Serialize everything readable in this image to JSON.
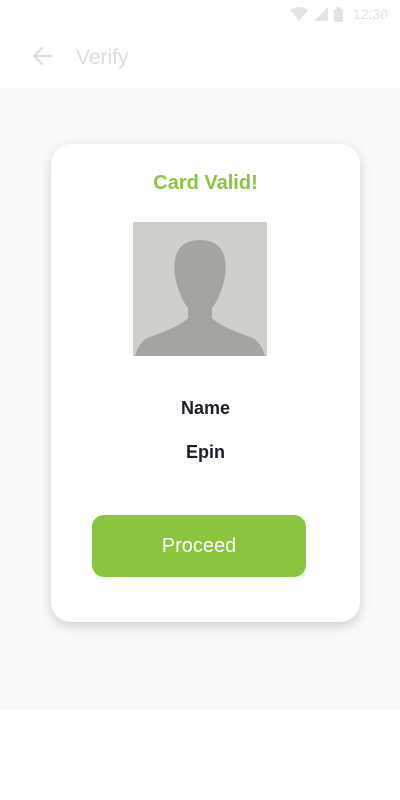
{
  "status_bar": {
    "time": "12:30",
    "icons": [
      "wifi-icon",
      "cell-signal-icon",
      "battery-icon"
    ]
  },
  "app_bar": {
    "back_icon": "arrow-left-icon",
    "title": "Verify"
  },
  "card": {
    "title": "Card Valid!",
    "avatar_icon": "person-silhouette-icon",
    "name_label": "Name",
    "name_value": "Epin",
    "proceed_label": "Proceed"
  },
  "colors": {
    "accent": "#8bc53f",
    "text_dark": "#1b1e2b",
    "muted": "#dcdcdc"
  }
}
